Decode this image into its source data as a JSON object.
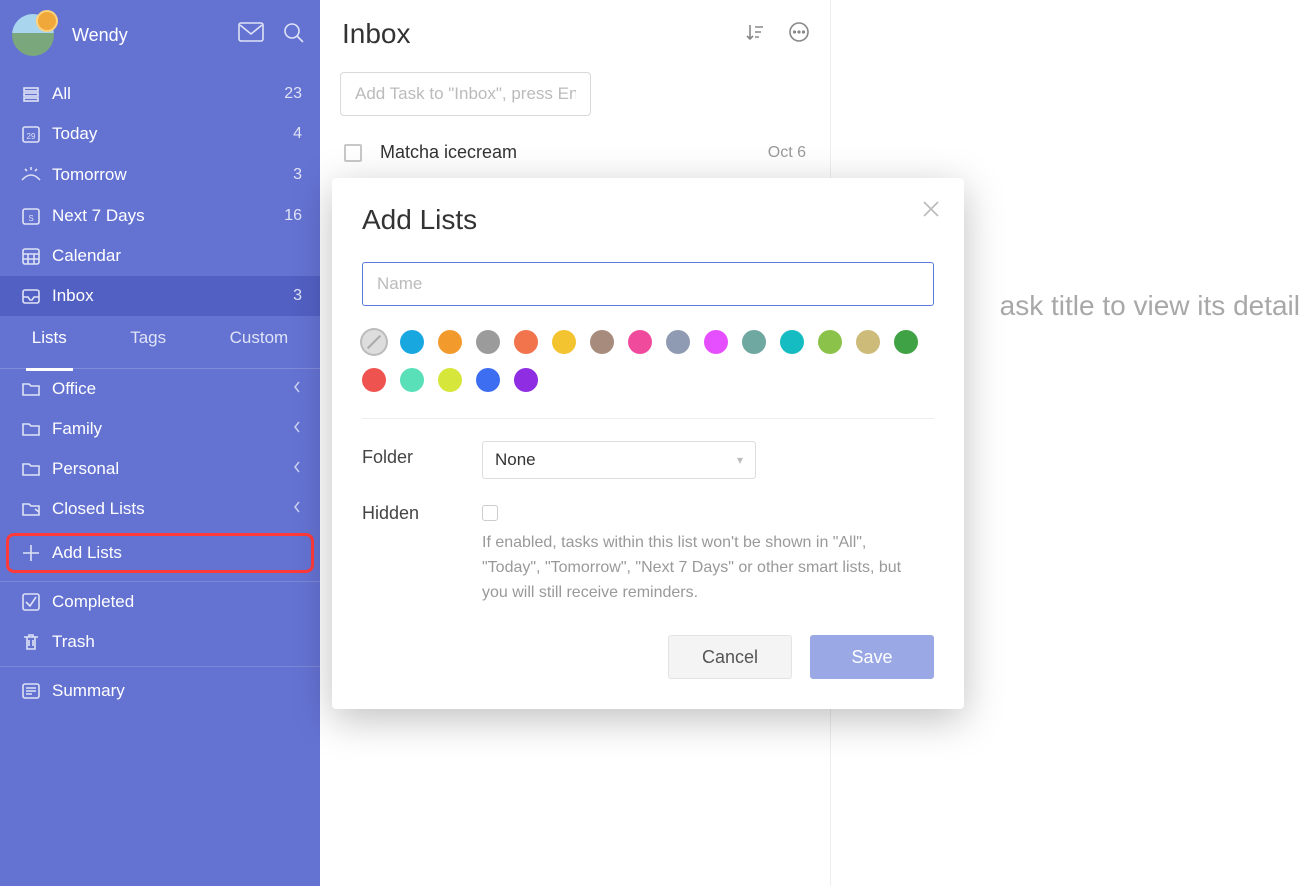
{
  "user": {
    "name": "Wendy"
  },
  "smart_lists": [
    {
      "key": "all",
      "label": "All",
      "count": 23,
      "icon": "stack"
    },
    {
      "key": "today",
      "label": "Today",
      "count": 4,
      "icon": "cal29"
    },
    {
      "key": "tomorrow",
      "label": "Tomorrow",
      "count": 3,
      "icon": "sun"
    },
    {
      "key": "next7",
      "label": "Next 7 Days",
      "count": 16,
      "icon": "calS"
    },
    {
      "key": "calendar",
      "label": "Calendar",
      "count": "",
      "icon": "calgrid"
    },
    {
      "key": "inbox",
      "label": "Inbox",
      "count": 3,
      "icon": "inbox",
      "selected": true
    }
  ],
  "nav_tabs": {
    "lists": "Lists",
    "tags": "Tags",
    "custom": "Custom",
    "active": "lists"
  },
  "folders": [
    {
      "label": "Office"
    },
    {
      "label": "Family"
    },
    {
      "label": "Personal"
    },
    {
      "label": "Closed Lists",
      "variant": "closed"
    }
  ],
  "add_lists_label": "Add Lists",
  "bottom": {
    "completed": "Completed",
    "trash": "Trash",
    "summary": "Summary"
  },
  "main": {
    "title": "Inbox",
    "add_placeholder": "Add Task to \"Inbox\", press Enter to save",
    "tasks": [
      {
        "title": "Matcha icecream",
        "date": "Oct 6"
      }
    ]
  },
  "detail_hint": "ask title to view its detail",
  "modal": {
    "title": "Add Lists",
    "name_placeholder": "Name",
    "folder_label": "Folder",
    "folder_value": "None",
    "hidden_label": "Hidden",
    "hidden_hint": "If enabled, tasks within this list won't be shown in \"All\", \"Today\", \"Tomorrow\", \"Next 7 Days\" or other smart lists, but you will still receive reminders.",
    "cancel": "Cancel",
    "save": "Save",
    "colors": [
      "none",
      "#19a7e0",
      "#f29b2c",
      "#9b9b9b",
      "#f2744d",
      "#f4c430",
      "#a78b7c",
      "#ef4a9b",
      "#8f9bb3",
      "#e64fff",
      "#6fa8a0",
      "#15bcc1",
      "#8bc34a",
      "#cdbb7a",
      "#3fa244",
      "#ef5350",
      "#5ae0b8",
      "#d6e63b",
      "#3d6df0",
      "#8e2de2"
    ]
  }
}
